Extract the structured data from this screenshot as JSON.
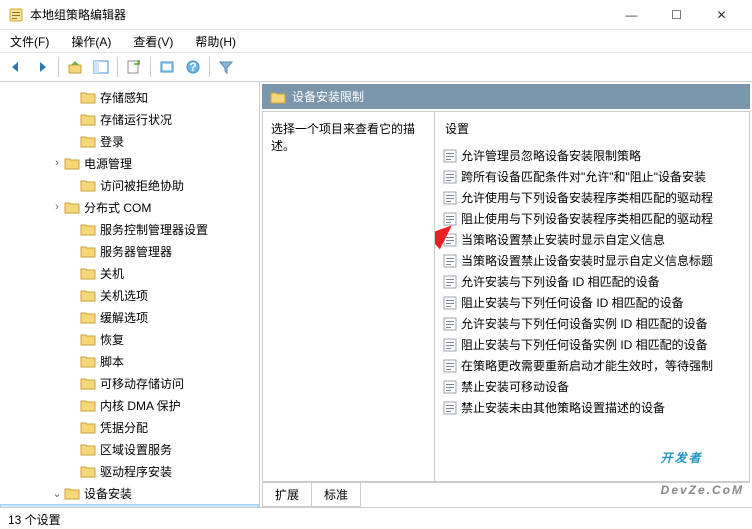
{
  "window": {
    "title": "本地组策略编辑器",
    "minimize": "—",
    "maximize": "☐",
    "close": "✕"
  },
  "menu": {
    "file": "文件(F)",
    "action": "操作(A)",
    "view": "查看(V)",
    "help": "帮助(H)"
  },
  "tree": {
    "items": [
      {
        "indent": 66,
        "twisty": "",
        "label": "存储感知"
      },
      {
        "indent": 66,
        "twisty": "",
        "label": "存储运行状况"
      },
      {
        "indent": 66,
        "twisty": "",
        "label": "登录"
      },
      {
        "indent": 50,
        "twisty": "›",
        "label": "电源管理"
      },
      {
        "indent": 66,
        "twisty": "",
        "label": "访问被拒绝协助"
      },
      {
        "indent": 50,
        "twisty": "›",
        "label": "分布式 COM"
      },
      {
        "indent": 66,
        "twisty": "",
        "label": "服务控制管理器设置"
      },
      {
        "indent": 66,
        "twisty": "",
        "label": "服务器管理器"
      },
      {
        "indent": 66,
        "twisty": "",
        "label": "关机"
      },
      {
        "indent": 66,
        "twisty": "",
        "label": "关机选项"
      },
      {
        "indent": 66,
        "twisty": "",
        "label": "缓解选项"
      },
      {
        "indent": 66,
        "twisty": "",
        "label": "恢复"
      },
      {
        "indent": 66,
        "twisty": "",
        "label": "脚本"
      },
      {
        "indent": 66,
        "twisty": "",
        "label": "可移动存储访问"
      },
      {
        "indent": 66,
        "twisty": "",
        "label": "内核 DMA 保护"
      },
      {
        "indent": 66,
        "twisty": "",
        "label": "凭据分配"
      },
      {
        "indent": 66,
        "twisty": "",
        "label": "区域设置服务"
      },
      {
        "indent": 66,
        "twisty": "",
        "label": "驱动程序安装"
      },
      {
        "indent": 50,
        "twisty": "⌄",
        "label": "设备安装"
      },
      {
        "indent": 82,
        "twisty": "",
        "label": "设备安装限制",
        "selected": true
      }
    ]
  },
  "right": {
    "header": "设备安装限制",
    "description": "选择一个项目来查看它的描述。",
    "settings_header": "设置",
    "settings": [
      "允许管理员忽略设备安装限制策略",
      "跨所有设备匹配条件对\"允许\"和\"阻止\"设备安装",
      "允许使用与下列设备安装程序类相匹配的驱动程",
      "阻止使用与下列设备安装程序类相匹配的驱动程",
      "当策略设置禁止安装时显示自定义信息",
      "当策略设置禁止设备安装时显示自定义信息标题",
      "允许安装与下列设备 ID 相匹配的设备",
      "阻止安装与下列任何设备 ID 相匹配的设备",
      "允许安装与下列任何设备实例 ID 相匹配的设备",
      "阻止安装与下列任何设备实例 ID 相匹配的设备",
      "在策略更改需要重新启动才能生效时，等待强制",
      "禁止安装可移动设备",
      "禁止安装未由其他策略设置描述的设备"
    ]
  },
  "tabs": {
    "extended": "扩展",
    "standard": "标准"
  },
  "statusbar": "13 个设置",
  "watermark": {
    "part1": "开发者",
    "part2": "DevZe.CoM"
  }
}
